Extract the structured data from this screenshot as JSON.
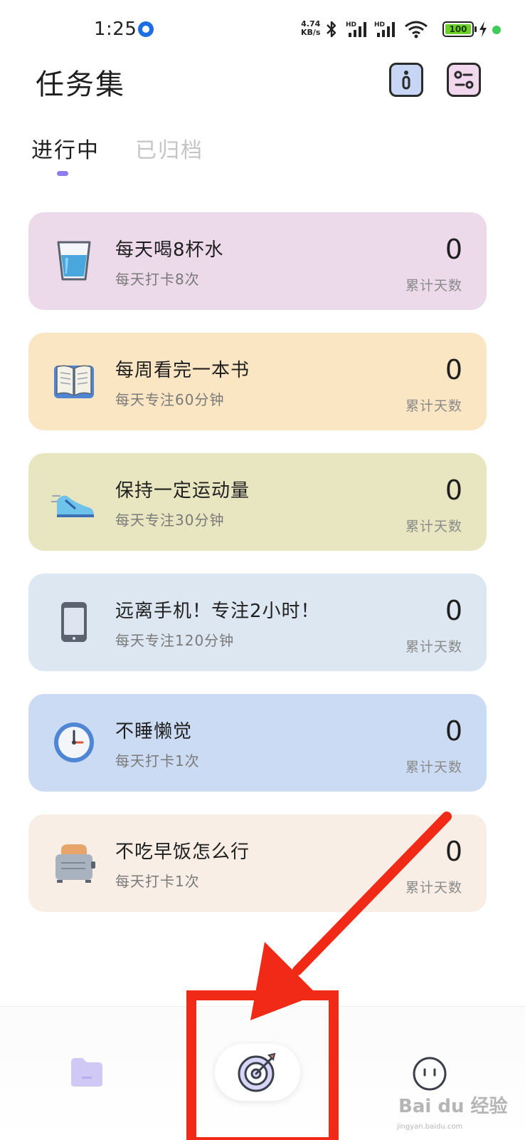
{
  "status_bar": {
    "time": "1:25",
    "net_speed_value": "4.74",
    "net_speed_unit": "KB/s",
    "battery_level": "100",
    "signal_1_label": "HD",
    "signal_2_label": "HD"
  },
  "header": {
    "title": "任务集",
    "info_icon": "info-icon",
    "settings_icon": "settings-icon"
  },
  "tabs": [
    {
      "label": "进行中",
      "active": true
    },
    {
      "label": "已归档",
      "active": false
    }
  ],
  "tasks": [
    {
      "name": "每天喝8杯水",
      "subtitle": "每天打卡8次",
      "count": "0",
      "count_label": "累计天数",
      "icon": "water-glass-icon",
      "color": "#ecd9e9"
    },
    {
      "name": "每周看完一本书",
      "subtitle": "每天专注60分钟",
      "count": "0",
      "count_label": "累计天数",
      "icon": "book-icon",
      "color": "#fbe6c4"
    },
    {
      "name": "保持一定运动量",
      "subtitle": "每天专注30分钟",
      "count": "0",
      "count_label": "累计天数",
      "icon": "sneaker-icon",
      "color": "#e8e6c0"
    },
    {
      "name": "远离手机！专注2小时！",
      "subtitle": "每天专注120分钟",
      "count": "0",
      "count_label": "累计天数",
      "icon": "phone-icon",
      "color": "#dce7f1"
    },
    {
      "name": "不睡懒觉",
      "subtitle": "每天打卡1次",
      "count": "0",
      "count_label": "累计天数",
      "icon": "clock-icon",
      "color": "#cbdbf3"
    },
    {
      "name": "不吃早饭怎么行",
      "subtitle": "每天打卡1次",
      "count": "0",
      "count_label": "累计天数",
      "icon": "toaster-icon",
      "color": "#f8eee6"
    }
  ],
  "bottom_nav": {
    "items": [
      "folder-icon",
      "target-icon",
      "face-icon"
    ]
  },
  "watermark": {
    "text": "Bai du 经验",
    "sub": "jingyan.baidu.com"
  }
}
